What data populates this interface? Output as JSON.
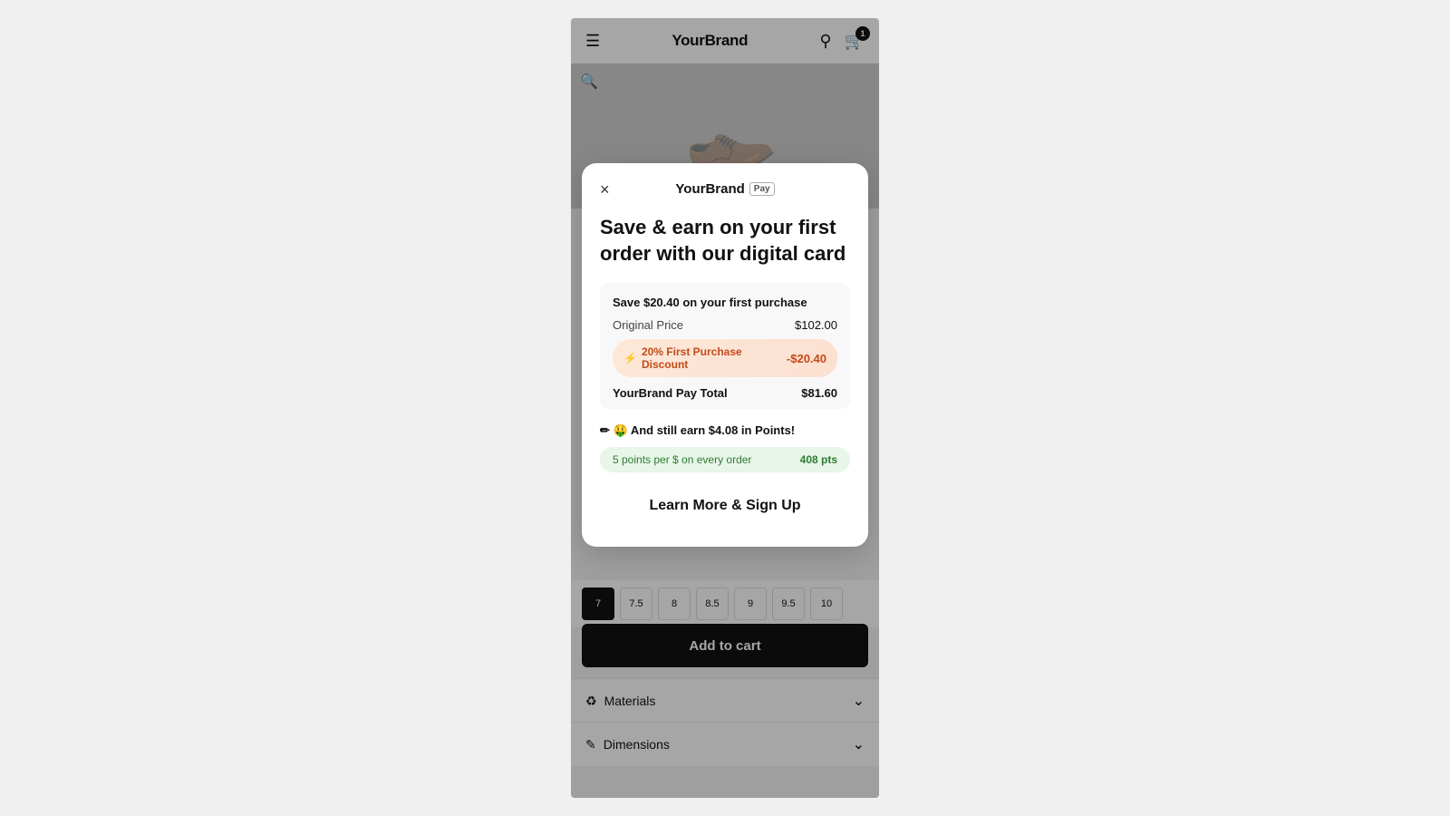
{
  "page": {
    "background_color": "#f0f0f0"
  },
  "nav": {
    "brand": "YourBrand",
    "cart_count": "1",
    "search_label": "search",
    "menu_label": "menu"
  },
  "product": {
    "zoom_label": "zoom"
  },
  "size_selector": {
    "sizes": [
      "7",
      "7.5",
      "8",
      "8.5",
      "9",
      "9.5",
      "10"
    ],
    "selected_index": 0
  },
  "add_to_cart": {
    "label": "Add to cart"
  },
  "materials": {
    "label": "Materials",
    "icon": "♻"
  },
  "dimensions": {
    "label": "Dimensions",
    "icon": "✏"
  },
  "modal": {
    "close_label": "×",
    "logo_brand": "YourBrand",
    "logo_pay": "Pay",
    "title": "Save & earn on your first order with our digital card",
    "savings_card": {
      "header": "Save $20.40 on your first purchase",
      "original_price_label": "Original Price",
      "original_price_value": "$102.00",
      "discount_icon": "⚡",
      "discount_label": "20% First Purchase Discount",
      "discount_value": "-$20.40",
      "total_label": "YourBrand Pay Total",
      "total_value": "$81.60"
    },
    "points_section": {
      "title": "✏ 🤑 And still earn $4.08 in Points!",
      "rate_label": "5 points per $ on every order",
      "points_total": "408 pts"
    },
    "cta_label": "Learn More & Sign Up"
  }
}
